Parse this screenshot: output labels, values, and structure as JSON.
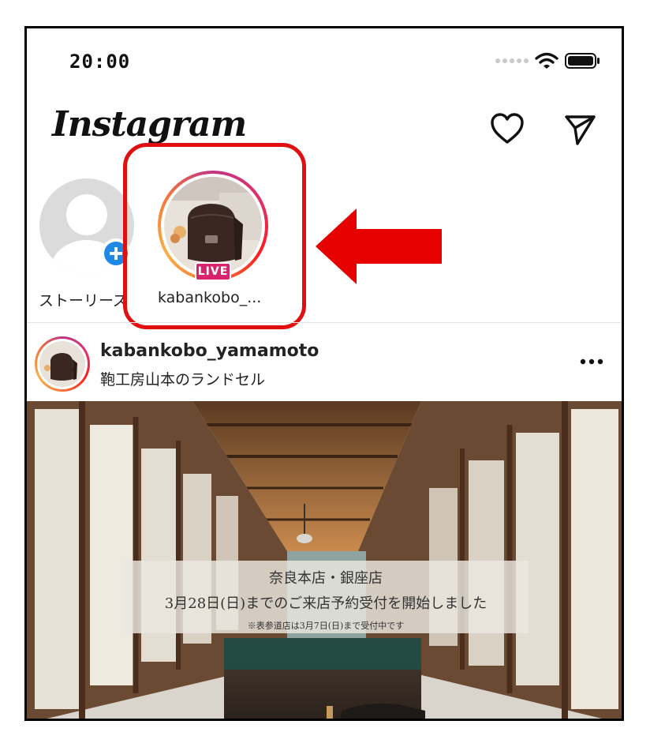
{
  "status_bar": {
    "time": "20:00"
  },
  "header": {
    "logo": "Instagram"
  },
  "stories": [
    {
      "label": "ストーリーズ"
    },
    {
      "label": "kabankobo_...",
      "badge": "LIVE"
    }
  ],
  "post": {
    "username": "kabankobo_yamamoto",
    "subtitle": "鞄工房山本のランドセル",
    "overlay": {
      "line1": "奈良本店・銀座店",
      "line2": "3月28日(日)までのご来店予約受付を開始しました",
      "line3": "※表参道店は3月7日(日)まで受付中です"
    }
  },
  "colors": {
    "highlight": "#e01010",
    "live_badge": "#d8246c",
    "add_story": "#1e88e5"
  },
  "icons": [
    "signal-dots-icon",
    "wifi-icon",
    "battery-icon",
    "heart-icon",
    "send-icon",
    "add-story-icon",
    "more-icon"
  ]
}
